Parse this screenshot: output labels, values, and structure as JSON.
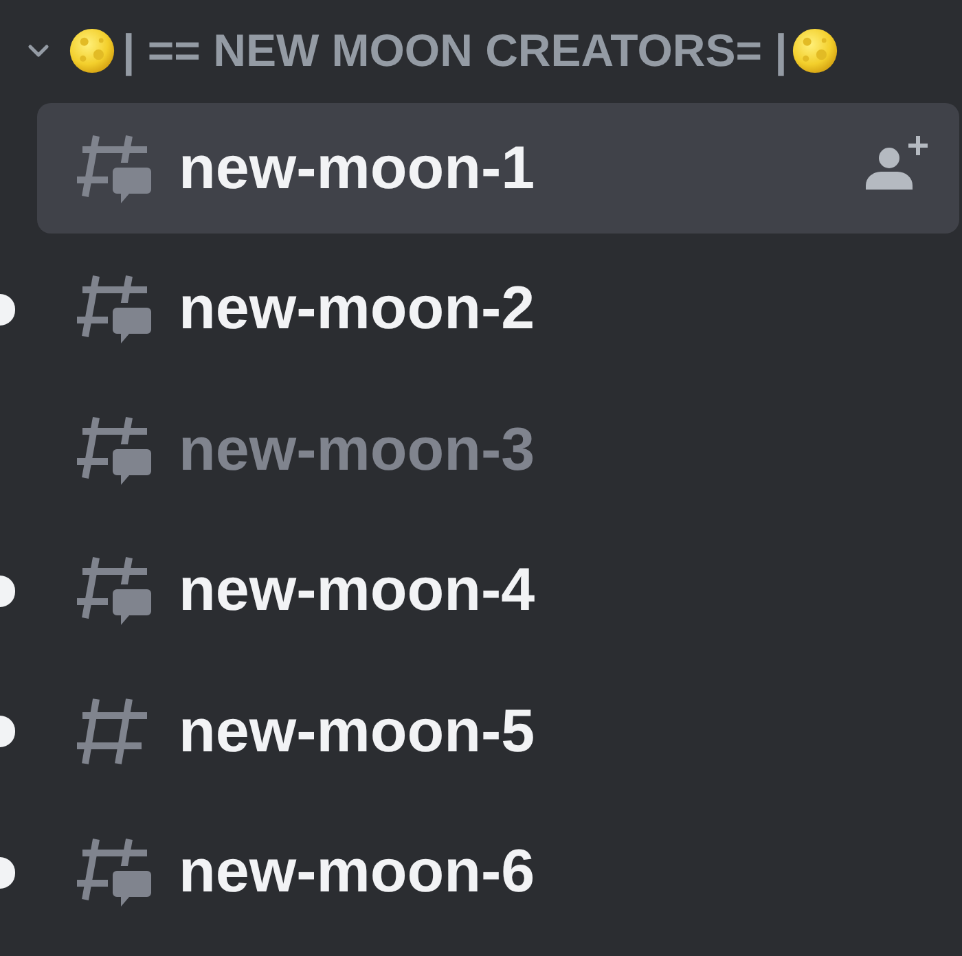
{
  "category": {
    "title": "| == NEW MOON CREATORS= |",
    "expanded": true
  },
  "channels": [
    {
      "name": "new-moon-1",
      "kind": "threads",
      "selected": true,
      "unread": false
    },
    {
      "name": "new-moon-2",
      "kind": "threads",
      "selected": false,
      "unread": true
    },
    {
      "name": "new-moon-3",
      "kind": "threads",
      "selected": false,
      "unread": false
    },
    {
      "name": "new-moon-4",
      "kind": "threads",
      "selected": false,
      "unread": true
    },
    {
      "name": "new-moon-5",
      "kind": "text",
      "selected": false,
      "unread": true
    },
    {
      "name": "new-moon-6",
      "kind": "threads",
      "selected": false,
      "unread": true
    }
  ]
}
